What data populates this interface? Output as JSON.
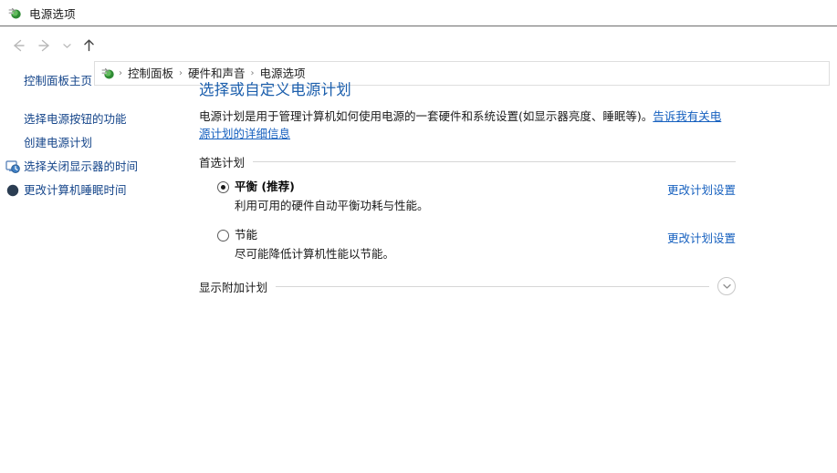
{
  "window": {
    "title": "电源选项",
    "icon": "power-plug-icon"
  },
  "nav": {
    "back_icon": "back-arrow-icon",
    "forward_icon": "forward-arrow-icon",
    "recent_icon": "chevron-down-icon",
    "up_icon": "up-arrow-icon",
    "address_icon": "power-plug-icon",
    "breadcrumbs": [
      {
        "label": "控制面板"
      },
      {
        "label": "硬件和声音"
      },
      {
        "label": "电源选项"
      }
    ],
    "separator": "›"
  },
  "sidebar": {
    "home": {
      "label": "控制面板主页",
      "icon": null
    },
    "items": [
      {
        "label": "选择电源按钮的功能",
        "icon": null
      },
      {
        "label": "创建电源计划",
        "icon": null
      },
      {
        "label": "选择关闭显示器的时间",
        "icon": "monitor-clock-icon"
      },
      {
        "label": "更改计算机睡眠时间",
        "icon": "sleep-moon-icon"
      }
    ]
  },
  "main": {
    "title": "选择或自定义电源计划",
    "description_text": "电源计划是用于管理计算机如何使用电源的一套硬件和系统设置(如显示器亮度、睡眠等)。",
    "description_link": "告诉我有关电源计划的详细信息",
    "group_label": "首选计划",
    "plans": [
      {
        "name": "平衡 (推荐)",
        "description": "利用可用的硬件自动平衡功耗与性能。",
        "selected": true,
        "link": "更改计划设置"
      },
      {
        "name": "节能",
        "description": "尽可能降低计算机性能以节能。",
        "selected": false,
        "link": "更改计划设置"
      }
    ],
    "expander": {
      "label": "显示附加计划",
      "icon": "chevron-down-circle-icon"
    }
  },
  "colors": {
    "title_blue": "#1c5fad",
    "link_blue": "#1660bf",
    "sidebar_link": "#15458a",
    "rule_gray": "#d6d6d6"
  }
}
